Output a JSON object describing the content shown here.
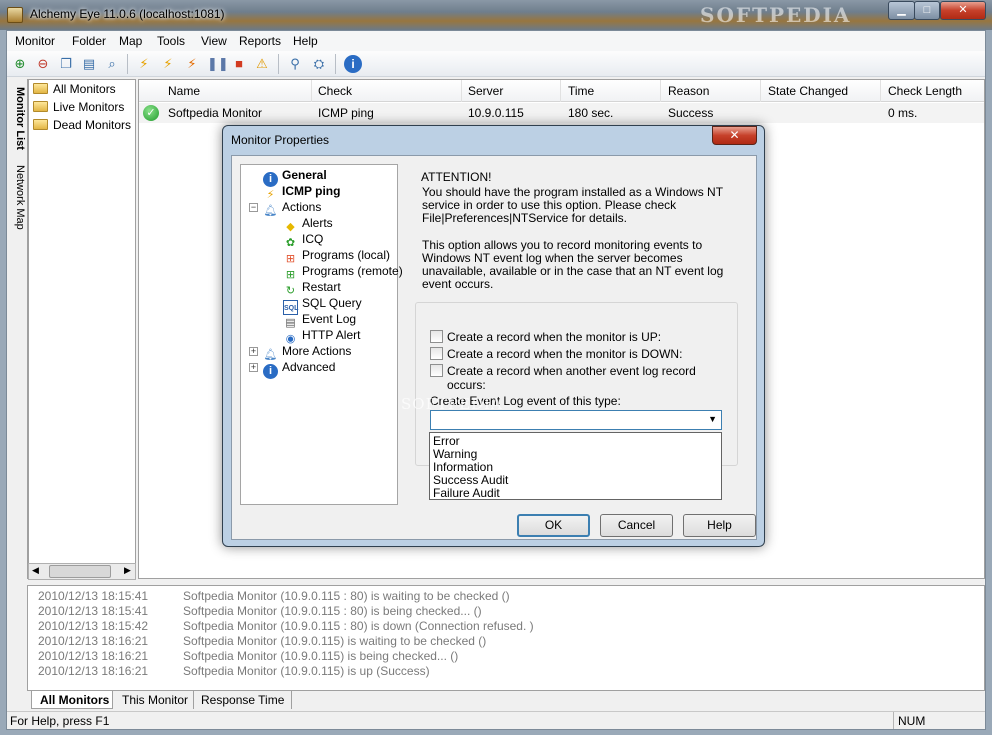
{
  "window": {
    "title": "Alchemy Eye 11.0.6 (localhost:1081)",
    "watermark": "SOFTPEDIA"
  },
  "menu": [
    "Monitor",
    "Folder",
    "Map",
    "Tools",
    "View",
    "Reports",
    "Help"
  ],
  "toolbar": {
    "icons": [
      "add-monitor-icon",
      "remove-monitor-icon",
      "copy-monitor-icon",
      "properties-icon",
      "find-icon",
      "lightning-icon",
      "lightning-all-icon",
      "lightning-stop-icon",
      "pause-icon",
      "stop-icon",
      "warning-icon",
      "connect-icon",
      "network-icon",
      "info-icon"
    ]
  },
  "vertical_tabs": {
    "monitor_list": "Monitor List",
    "network_map": "Network Map"
  },
  "tree": [
    "All Monitors",
    "Live Monitors",
    "Dead Monitors"
  ],
  "list": {
    "columns": [
      "Name",
      "Check",
      "Server",
      "Time",
      "Reason",
      "State Changed",
      "Check Length"
    ],
    "rows": [
      {
        "name": "Softpedia Monitor",
        "check": "ICMP ping",
        "server": "10.9.0.115",
        "time": "180 sec.",
        "reason": "Success",
        "state_changed": "",
        "check_length": "0 ms."
      }
    ]
  },
  "log": [
    {
      "time": "2010/12/13 18:15:41",
      "msg": "Softpedia Monitor (10.9.0.115 : 80) is waiting to be checked ()"
    },
    {
      "time": "2010/12/13 18:15:41",
      "msg": "Softpedia Monitor (10.9.0.115 : 80) is being checked... ()"
    },
    {
      "time": "2010/12/13 18:15:42",
      "msg": "Softpedia Monitor (10.9.0.115 : 80) is down (Connection refused. )"
    },
    {
      "time": "2010/12/13 18:16:21",
      "msg": "Softpedia Monitor (10.9.0.115) is waiting to be checked ()"
    },
    {
      "time": "2010/12/13 18:16:21",
      "msg": "Softpedia Monitor (10.9.0.115) is being checked... ()"
    },
    {
      "time": "2010/12/13 18:16:21",
      "msg": "Softpedia Monitor (10.9.0.115) is up (Success)"
    }
  ],
  "log_tabs": [
    "All Monitors",
    "This Monitor",
    "Response Time"
  ],
  "status": {
    "help": "For Help, press F1",
    "num": "NUM"
  },
  "dialog": {
    "title": "Monitor Properties",
    "tree": {
      "general": "General",
      "icmp": "ICMP ping",
      "actions": "Actions",
      "children": [
        "Alerts",
        "ICQ",
        "Programs (local)",
        "Programs (remote)",
        "Restart",
        "SQL Query",
        "Event Log",
        "HTTP Alert"
      ],
      "more_actions": "More Actions",
      "advanced": "Advanced"
    },
    "attention": "ATTENTION!",
    "para1": "You should have the program installed as a Windows NT service in order to use this option. Please check File|Preferences|NTService for details.",
    "para2": "This option allows you to record monitoring events to Windows NT event log when the server becomes unavailable, available or in the case that an NT event log event occurs.",
    "checkboxes": [
      "Create a record when the monitor is UP:",
      "Create a record when the monitor is DOWN:",
      "Create a record when another event log record occurs:"
    ],
    "combo_label": "Create Event Log event of this type:",
    "combo_value": "",
    "options": [
      "Error",
      "Warning",
      "Information",
      "Success Audit",
      "Failure Audit"
    ],
    "buttons": {
      "ok": "OK",
      "cancel": "Cancel",
      "help": "Help"
    },
    "watermark": "SOFTPEDIA"
  }
}
